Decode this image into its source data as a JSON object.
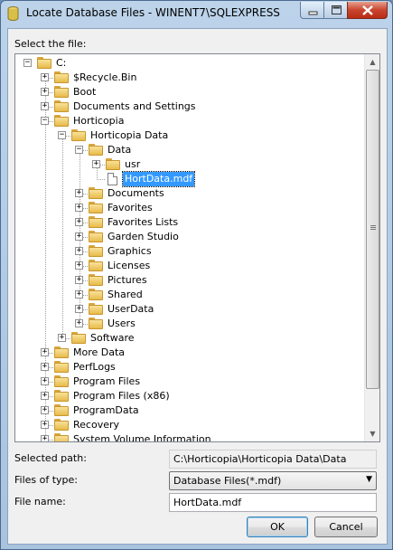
{
  "window": {
    "title": "Locate Database Files - WINENT7\\SQLEXPRESS"
  },
  "select_label": "Select the file:",
  "tree": {
    "items": [
      {
        "label": "C:",
        "depth": 0,
        "expander": "−",
        "icon": "folder"
      },
      {
        "label": "$Recycle.Bin",
        "depth": 1,
        "expander": "+",
        "icon": "folder"
      },
      {
        "label": "Boot",
        "depth": 1,
        "expander": "+",
        "icon": "folder"
      },
      {
        "label": "Documents and Settings",
        "depth": 1,
        "expander": "+",
        "icon": "folder"
      },
      {
        "label": "Horticopia",
        "depth": 1,
        "expander": "−",
        "icon": "folder"
      },
      {
        "label": "Horticopia Data",
        "depth": 2,
        "expander": "−",
        "icon": "folder"
      },
      {
        "label": "Data",
        "depth": 3,
        "expander": "−",
        "icon": "folder"
      },
      {
        "label": "usr",
        "depth": 4,
        "expander": "+",
        "icon": "folder"
      },
      {
        "label": "HortData.mdf",
        "depth": 4,
        "expander": "",
        "icon": "file",
        "selected": true
      },
      {
        "label": "Documents",
        "depth": 3,
        "expander": "+",
        "icon": "folder"
      },
      {
        "label": "Favorites",
        "depth": 3,
        "expander": "+",
        "icon": "folder"
      },
      {
        "label": "Favorites Lists",
        "depth": 3,
        "expander": "+",
        "icon": "folder"
      },
      {
        "label": "Garden Studio",
        "depth": 3,
        "expander": "+",
        "icon": "folder"
      },
      {
        "label": "Graphics",
        "depth": 3,
        "expander": "+",
        "icon": "folder"
      },
      {
        "label": "Licenses",
        "depth": 3,
        "expander": "+",
        "icon": "folder"
      },
      {
        "label": "Pictures",
        "depth": 3,
        "expander": "+",
        "icon": "folder"
      },
      {
        "label": "Shared",
        "depth": 3,
        "expander": "+",
        "icon": "folder"
      },
      {
        "label": "UserData",
        "depth": 3,
        "expander": "+",
        "icon": "folder"
      },
      {
        "label": "Users",
        "depth": 3,
        "expander": "+",
        "icon": "folder"
      },
      {
        "label": "Software",
        "depth": 2,
        "expander": "+",
        "icon": "folder"
      },
      {
        "label": "More Data",
        "depth": 1,
        "expander": "+",
        "icon": "folder"
      },
      {
        "label": "PerfLogs",
        "depth": 1,
        "expander": "+",
        "icon": "folder"
      },
      {
        "label": "Program Files",
        "depth": 1,
        "expander": "+",
        "icon": "folder"
      },
      {
        "label": "Program Files (x86)",
        "depth": 1,
        "expander": "+",
        "icon": "folder"
      },
      {
        "label": "ProgramData",
        "depth": 1,
        "expander": "+",
        "icon": "folder"
      },
      {
        "label": "Recovery",
        "depth": 1,
        "expander": "+",
        "icon": "folder"
      },
      {
        "label": "System Volume Information",
        "depth": 1,
        "expander": "+",
        "icon": "folder"
      }
    ]
  },
  "selected_path": {
    "label": "Selected path:",
    "value": "C:\\Horticopia\\Horticopia Data\\Data"
  },
  "files_of_type": {
    "label": "Files of type:",
    "value": "Database Files(*.mdf)"
  },
  "file_name": {
    "label": "File name:",
    "value": "HortData.mdf"
  },
  "buttons": {
    "ok": "OK",
    "cancel": "Cancel"
  },
  "colors": {
    "selection": "#3399ff",
    "titlebar": "#bcd3ea",
    "close_button": "#c9452f"
  }
}
